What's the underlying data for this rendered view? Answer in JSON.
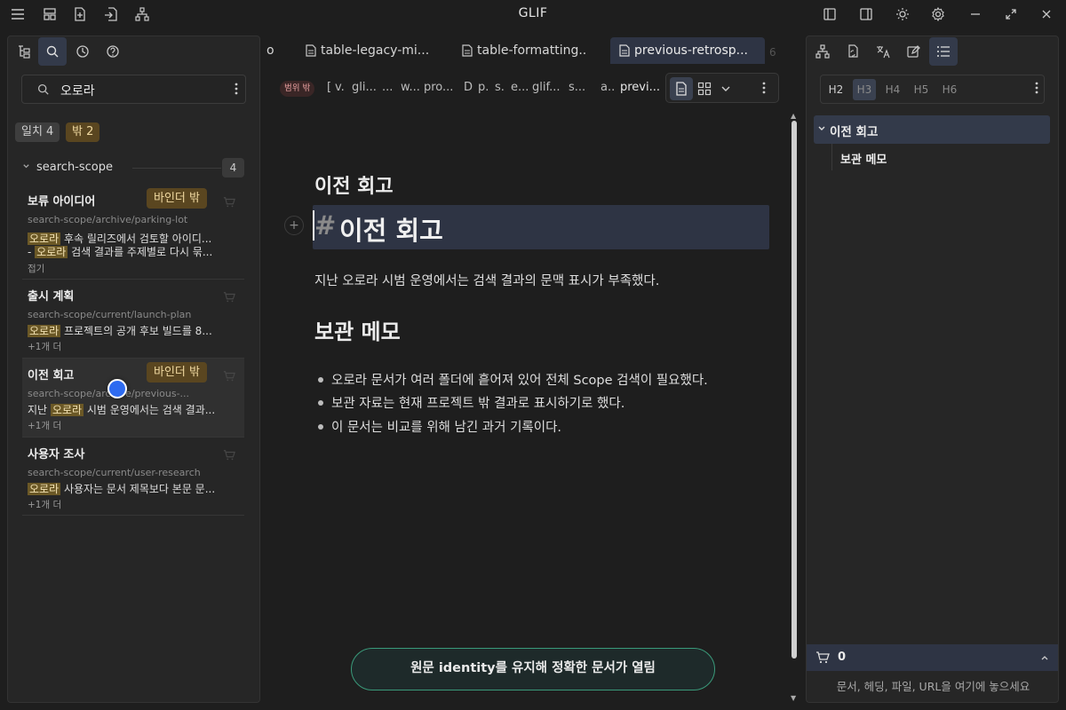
{
  "window": {
    "title": "GLIF"
  },
  "left_panel": {
    "search": {
      "value": "오로라"
    },
    "chips": {
      "match": "일치 4",
      "out": "밖 2"
    },
    "group": {
      "label": "search-scope",
      "count": "4"
    },
    "results": [
      {
        "title": "보류 아이디어",
        "badge": "바인더 밖",
        "path": "search-scope/archive/parking-lot",
        "line1_hl": "오로라",
        "line1_rest": " 후속 릴리즈에서 검토할 아이디...",
        "line2_pre": "- ",
        "line2_hl": "오로라",
        "line2_rest": " 검색 결과를 주제별로 다시 묶...",
        "footer": "접기"
      },
      {
        "title": "출시 계획",
        "badge": "",
        "path": "search-scope/current/launch-plan",
        "line1_hl": "오로라",
        "line1_rest": " 프로젝트의 공개 후보 빌드를 8...",
        "footer": "+1개 더"
      },
      {
        "title": "이전 회고",
        "badge": "바인더 밖",
        "path": "search-scope/archive/previous-...",
        "line1_pre": "지난 ",
        "line1_hl": "오로라",
        "line1_rest": " 시범 운영에서는 검색 결과...",
        "footer": "+1개 더"
      },
      {
        "title": "사용자 조사",
        "badge": "",
        "path": "search-scope/current/user-research",
        "line1_hl": "오로라",
        "line1_rest": " 사용자는 문서 제목보다 본문 문...",
        "footer": "+1개 더"
      }
    ]
  },
  "tabs": {
    "t0": "o",
    "t1": "table-legacy-mi...",
    "t2": "table-formatting...",
    "t3": "previous-retrosp...",
    "more": "6"
  },
  "breadcrumb": {
    "scope_badge": "범위 밖",
    "items": [
      "[",
      "v.",
      "gli...",
      "...",
      "w...",
      "pro...",
      "D",
      "p.",
      "s.",
      "e...",
      "glif...",
      "s...",
      "a.."
    ],
    "last": "previ..."
  },
  "document": {
    "title": "이전 회고",
    "h1_hash": "#",
    "h1_text": "이전 회고",
    "paragraph": "지난 오로라 시범 운영에서는 검색 결과의 문맥 표시가 부족했다.",
    "h2": "보관 메모",
    "bullets": [
      "오로라 문서가 여러 폴더에 흩어져 있어 전체 Scope 검색이 필요했다.",
      "보관 자료는 현재 프로젝트 밖 결과로 표시하기로 했다.",
      "이 문서는 비교를 위해 남긴 과거 기록이다."
    ]
  },
  "toast": {
    "text": "원문 identity를 유지해 정확한 문서가 열림"
  },
  "right_panel": {
    "heading_levels": [
      "H2",
      "H3",
      "H4",
      "H5",
      "H6"
    ],
    "active_level": "H3",
    "outline": [
      {
        "label": "이전 회고",
        "level": 1,
        "active": true
      },
      {
        "label": "보관 메모",
        "level": 2,
        "active": false
      }
    ],
    "cart": {
      "count": "0"
    },
    "drop_hint": "문서, 헤딩, 파일, URL을 여기에 놓으세요"
  },
  "colors": {
    "accent": "#2e3444",
    "badge_bg": "#5a4620",
    "badge_fg": "#f0d9a0",
    "toast_border": "#3a9a7a",
    "cursor": "#2e6bf0"
  }
}
